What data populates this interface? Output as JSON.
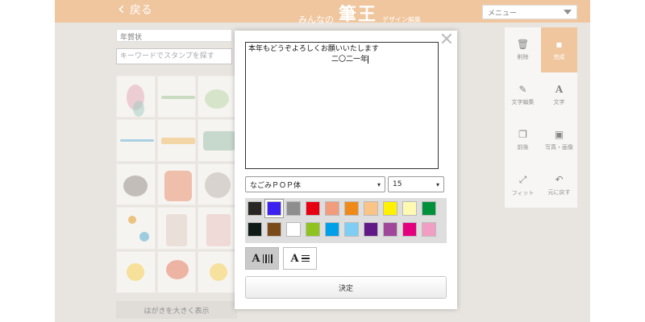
{
  "header": {
    "back_label": "戻る",
    "brand_small": "みんなの",
    "brand_big": "筆王",
    "brand_sub": "デザイン編集",
    "menu_label": "メニュー"
  },
  "left_panel": {
    "category": "年賀状",
    "search_placeholder": "キーワードでスタンプを探す",
    "show_large": "はがきを大きく表示"
  },
  "tools": [
    {
      "label": "削除",
      "icon": "trash-icon",
      "glyph": "🗑"
    },
    {
      "label": "完成",
      "icon": "finish-icon",
      "glyph": "▪",
      "active": true
    },
    {
      "label": "文字編集",
      "icon": "pencil-icon",
      "glyph": "✎"
    },
    {
      "label": "文字",
      "icon": "text-icon",
      "glyph": "A"
    },
    {
      "label": "前後",
      "icon": "layers-icon",
      "glyph": "❐"
    },
    {
      "label": "写真・画像",
      "icon": "image-icon",
      "glyph": "▣"
    },
    {
      "label": "フィット",
      "icon": "fit-icon",
      "glyph": "⤢"
    },
    {
      "label": "元に戻す",
      "icon": "undo-icon",
      "glyph": "↶"
    }
  ],
  "modal": {
    "close_glyph": "✕",
    "text_line1": "本年もどうぞよろしくお願いいたします",
    "text_line2": "二〇二一年",
    "font_selected": "なごみＰＯＰ体",
    "size_selected": "15",
    "colors_row1": [
      "#2a2624",
      "#3b22f0",
      "#8e8e8e",
      "#e60012",
      "#f19c7c",
      "#ef8a1a",
      "#fbc487",
      "#fff100",
      "#fff9b1",
      "#00913a"
    ],
    "colors_row2": [
      "#0f1b17",
      "#7a4a18",
      "#ffffff",
      "#8fc31f",
      "#00a0e9",
      "#7ecef4",
      "#601986",
      "#a0479a",
      "#e4007f",
      "#f19ec2"
    ],
    "selected_color": "#3b22f0",
    "orient_vertical_label": "A",
    "orient_horizontal_label": "A",
    "decide_label": "決定"
  }
}
